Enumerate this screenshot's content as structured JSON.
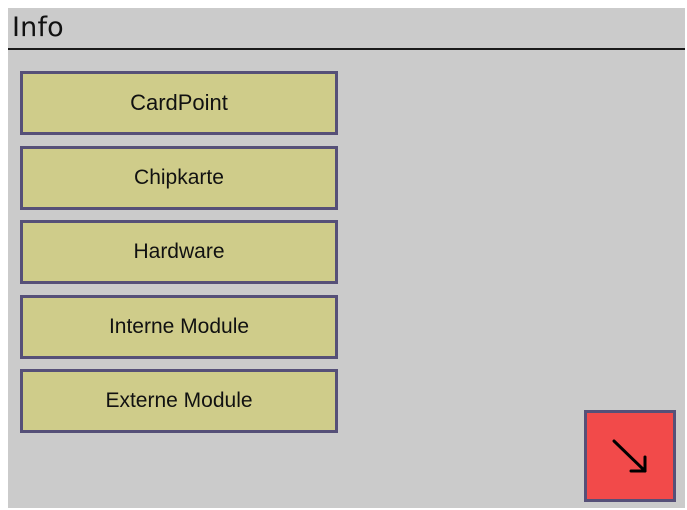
{
  "header": {
    "title": "Info"
  },
  "menu": {
    "items": [
      {
        "label": "CardPoint"
      },
      {
        "label": "Chipkarte"
      },
      {
        "label": "Hardware"
      },
      {
        "label": "Interne Module"
      },
      {
        "label": "Externe Module"
      }
    ]
  },
  "nav": {
    "corner_button_icon": "arrow-down-right-icon"
  },
  "colors": {
    "screen_background": "#cbcbcb",
    "menu_button_fill": "#cfcc8a",
    "menu_button_border": "#565078",
    "corner_button_fill": "#f24a4a"
  }
}
